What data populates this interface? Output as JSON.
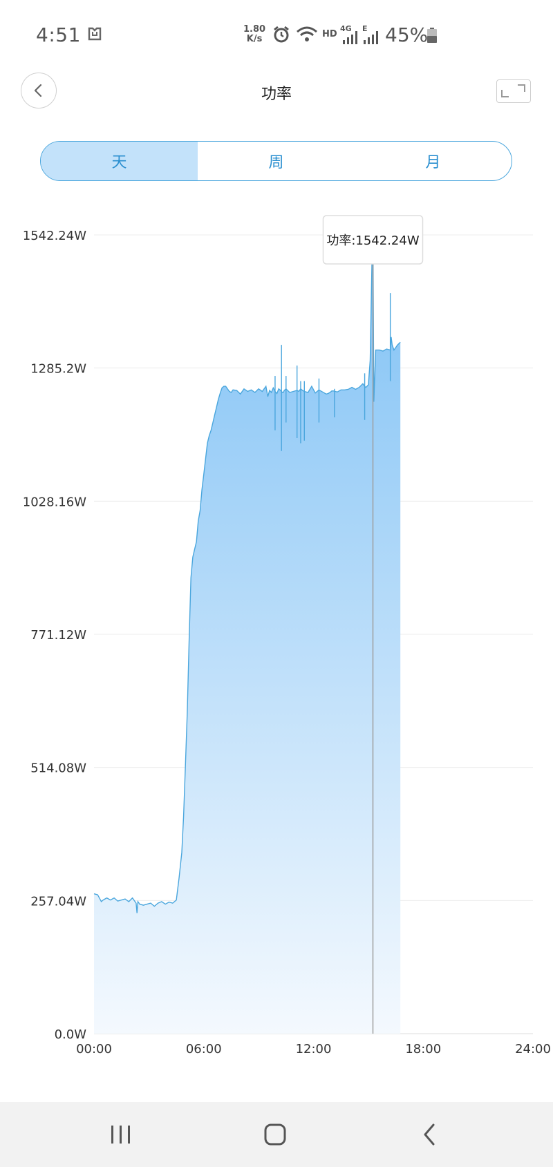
{
  "status_bar": {
    "time": "4:51",
    "speed_value": "1.80",
    "speed_unit": "K/s",
    "network_hd": "HD",
    "network_4g": "4G",
    "network_e": "E",
    "battery_percent": "45%"
  },
  "header": {
    "title": "功率"
  },
  "tabs": [
    {
      "label": "天",
      "active": true
    },
    {
      "label": "周",
      "active": false
    },
    {
      "label": "月",
      "active": false
    }
  ],
  "tooltip": {
    "text": "功率:1542.24W"
  },
  "chart_data": {
    "type": "area",
    "title": "",
    "xlabel": "",
    "ylabel": "",
    "x_ticks": [
      "00:00",
      "06:00",
      "12:00",
      "18:00",
      "24:00"
    ],
    "y_ticks": [
      "0.0W",
      "257.04W",
      "514.08W",
      "771.12W",
      "1028.16W",
      "1285.2W",
      "1542.24W"
    ],
    "xlim": [
      0,
      24
    ],
    "ylim": [
      0,
      1542.24
    ],
    "grid": true,
    "colors": {
      "line": "#4aa6dd",
      "fill_top": "#7fc1f5",
      "fill_bottom": "#f4f9fe",
      "cursor": "#9e9e9e"
    },
    "cursor_x": 15.25,
    "series": [
      {
        "values_x": [
          0.0,
          0.2,
          0.4,
          0.5,
          0.7,
          0.9,
          1.1,
          1.3,
          1.5,
          1.7,
          1.9,
          2.1,
          2.3,
          2.35,
          2.4,
          2.5,
          2.7,
          2.9,
          3.1,
          3.3,
          3.5,
          3.7,
          3.9,
          4.1,
          4.3,
          4.5,
          4.65,
          4.8,
          4.9,
          5.0,
          5.1,
          5.2,
          5.3,
          5.4,
          5.5,
          5.6,
          5.7,
          5.8,
          5.9,
          6.0,
          6.1,
          6.2,
          6.3,
          6.4,
          6.5,
          6.6,
          6.7,
          6.8,
          6.9,
          7.0,
          7.1,
          7.2,
          7.3,
          7.4,
          7.5,
          7.6,
          7.8,
          8.0,
          8.2,
          8.4,
          8.6,
          8.8,
          9.0,
          9.2,
          9.4,
          9.5,
          9.6,
          9.7,
          9.8,
          9.9,
          10.0,
          10.1,
          10.2,
          10.3,
          10.35,
          10.4,
          10.5,
          10.7,
          10.9,
          11.1,
          11.2,
          11.3,
          11.4,
          11.5,
          11.7,
          11.9,
          12.1,
          12.3,
          12.5,
          12.7,
          12.8,
          12.9,
          13.0,
          13.1,
          13.3,
          13.5,
          13.7,
          13.9,
          14.1,
          14.3,
          14.5,
          14.7,
          14.8,
          14.85,
          14.9,
          15.0,
          15.1,
          15.2,
          15.25,
          15.3,
          15.4,
          15.6,
          15.8,
          16.0,
          16.2,
          16.25,
          16.3,
          16.4,
          16.6,
          16.75
        ],
        "values_y": [
          270,
          268,
          255,
          258,
          262,
          258,
          262,
          256,
          258,
          260,
          255,
          262,
          252,
          233,
          255,
          250,
          248,
          250,
          252,
          246,
          252,
          255,
          250,
          254,
          252,
          258,
          300,
          350,
          420,
          520,
          620,
          760,
          880,
          920,
          935,
          950,
          990,
          1010,
          1050,
          1080,
          1110,
          1140,
          1155,
          1165,
          1180,
          1195,
          1210,
          1225,
          1237,
          1247,
          1250,
          1250,
          1245,
          1240,
          1238,
          1243,
          1242,
          1235,
          1245,
          1240,
          1243,
          1238,
          1245,
          1240,
          1250,
          1230,
          1242,
          1238,
          1247,
          1240,
          1236,
          1245,
          1242,
          1238,
          1238,
          1242,
          1245,
          1238,
          1240,
          1242,
          1240,
          1245,
          1242,
          1240,
          1238,
          1250,
          1237,
          1243,
          1239,
          1235,
          1236,
          1238,
          1241,
          1241,
          1239,
          1243,
          1243,
          1244,
          1248,
          1244,
          1248,
          1255,
          1250,
          1248,
          1249,
          1253,
          1300,
          1500,
          1542.24,
          1220,
          1320,
          1320,
          1318,
          1322,
          1320,
          1345,
          1330,
          1320,
          1330,
          1335
        ]
      }
    ],
    "spikes": [
      {
        "x": 9.9,
        "low": 1165,
        "high": 1270
      },
      {
        "x": 10.25,
        "low": 1125,
        "high": 1330
      },
      {
        "x": 10.5,
        "low": 1180,
        "high": 1270
      },
      {
        "x": 11.1,
        "low": 1150,
        "high": 1290
      },
      {
        "x": 11.3,
        "low": 1140,
        "high": 1260
      },
      {
        "x": 11.5,
        "low": 1145,
        "high": 1260
      },
      {
        "x": 12.3,
        "low": 1180,
        "high": 1265
      },
      {
        "x": 13.15,
        "low": 1190,
        "high": 1245
      },
      {
        "x": 14.8,
        "low": 1185,
        "high": 1275
      },
      {
        "x": 16.2,
        "low": 1260,
        "high": 1430
      }
    ]
  }
}
